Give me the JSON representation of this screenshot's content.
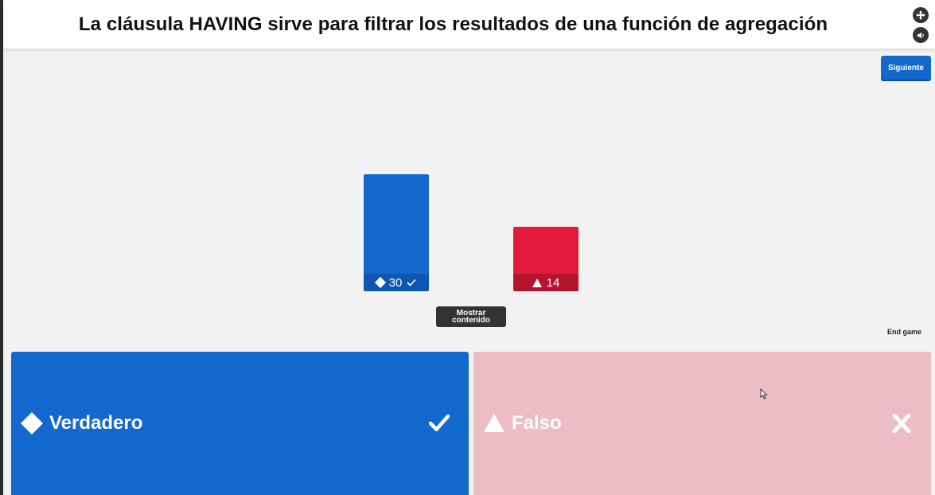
{
  "question": {
    "title": "La cláusula HAVING sirve para filtrar los resultados de una función de agregación"
  },
  "header_icons": {
    "fullscreen_icon": "fullscreen-icon",
    "sound_icon": "speaker-icon"
  },
  "controls": {
    "next_label": "Siguiente",
    "show_content_label": "Mostrar contenido",
    "end_game_label": "End game"
  },
  "chart_data": {
    "type": "bar",
    "categories": [
      "Verdadero",
      "Falso"
    ],
    "values": [
      30,
      14
    ],
    "colors": [
      "#1368ce",
      "#e21b3c"
    ],
    "icons": [
      "diamond-icon",
      "triangle-icon"
    ],
    "correct": [
      true,
      false
    ]
  },
  "results": [
    {
      "count": "30",
      "icon": "diamond-icon",
      "correct": true
    },
    {
      "count": "14",
      "icon": "triangle-icon",
      "correct": false
    }
  ],
  "answers": [
    {
      "label": "Verdadero",
      "icon": "diamond-icon",
      "status": "check-icon",
      "color": "#1368ce"
    },
    {
      "label": "Falso",
      "icon": "triangle-icon",
      "status": "cross-icon",
      "color": "#ebbdc5"
    }
  ],
  "colors": {
    "blue": "#1368ce",
    "red": "#e21b3c",
    "faded_red": "#ebbdc5",
    "dark_button": "#333333"
  }
}
